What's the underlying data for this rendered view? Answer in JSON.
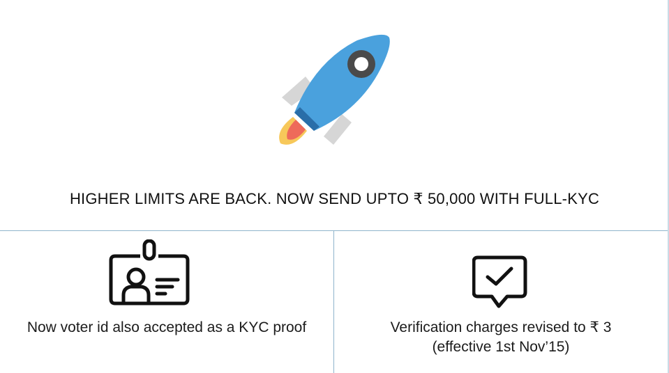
{
  "banner": {
    "headline": "HIGHER LIMITS ARE BACK. NOW SEND UPTO ₹ 50,000 WITH FULL-KYC",
    "icon": "rocket-icon",
    "colors": {
      "rocket_body": "#4aa1dd",
      "rocket_band": "#2a6ea8",
      "rocket_fins": "#d6d6d6",
      "rocket_window": "#4a4a4a",
      "flame_outer": "#f7c85a",
      "flame_inner": "#ee6a5a"
    }
  },
  "features": [
    {
      "icon": "id-card-icon",
      "caption": "Now voter id also accepted as a KYC proof"
    },
    {
      "icon": "checkmark-message-icon",
      "caption_line1": "Verification charges revised to ₹ 3",
      "caption_line2": "(effective 1st Nov’15)"
    }
  ],
  "colors": {
    "divider": "#8fb4cc",
    "text": "#1b1b1b",
    "background": "#ffffff"
  }
}
